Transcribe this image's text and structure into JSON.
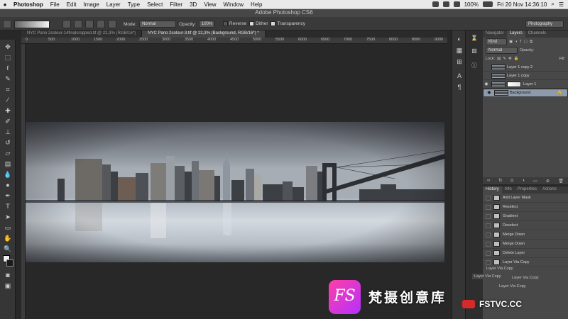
{
  "menubar": {
    "app_name": "Photoshop",
    "items": [
      "File",
      "Edit",
      "Image",
      "Layer",
      "Type",
      "Select",
      "Filter",
      "3D",
      "View",
      "Window",
      "Help"
    ],
    "battery": "100%",
    "datetime": "Fri 20 Nov  14:36:10"
  },
  "window": {
    "title": "Adobe Photoshop CS6"
  },
  "options": {
    "mode_label": "Mode:",
    "mode_value": "Normal",
    "opacity_label": "Opacity:",
    "opacity_value": "100%",
    "reverse_label": "Reverse",
    "dither_label": "Dither",
    "transparency_label": "Transparency",
    "workspace": "Photography"
  },
  "tabs": [
    {
      "label": "NYC Pano 2colour-14finalcropped.tif @ 22,3% (RGB/16*)"
    },
    {
      "label": "NYC Pano 2colour-3.tif @ 22,3% (Background, RGB/16*) *"
    }
  ],
  "ruler": [
    "0",
    "500",
    "1000",
    "1500",
    "2000",
    "2500",
    "3000",
    "3500",
    "4000",
    "4500",
    "5000",
    "5500",
    "6000",
    "6500",
    "7000",
    "7500",
    "8000",
    "8500",
    "9000"
  ],
  "layers_panel": {
    "tabs": [
      "Navigator",
      "Layers",
      "Channels"
    ],
    "kind_label": "Kind",
    "blend": "Normal",
    "opacity_label": "Opacity:",
    "lock_label": "Lock:",
    "fill_label": "Fill:",
    "layers": [
      {
        "name": "Layer 1 copy 2"
      },
      {
        "name": "Layer 1 copy"
      },
      {
        "name": "Layer 1"
      },
      {
        "name": "Background"
      }
    ]
  },
  "history_panel": {
    "tabs": [
      "History",
      "Info",
      "Properties",
      "Actions"
    ],
    "items": [
      "Add Layer Mask",
      "Reselect",
      "Gradient",
      "Deselect",
      "Merge Down",
      "Merge Down",
      "Delete Layer",
      "Layer Via Copy"
    ],
    "ghost_items": [
      "Layer Via Copy",
      "Layer Via Copy",
      "Layer Via Copy",
      "Layer Via Copy"
    ]
  },
  "watermark": {
    "logo": "FS",
    "chinese": "梵摄创意库",
    "url": "FSTVC.CC"
  }
}
